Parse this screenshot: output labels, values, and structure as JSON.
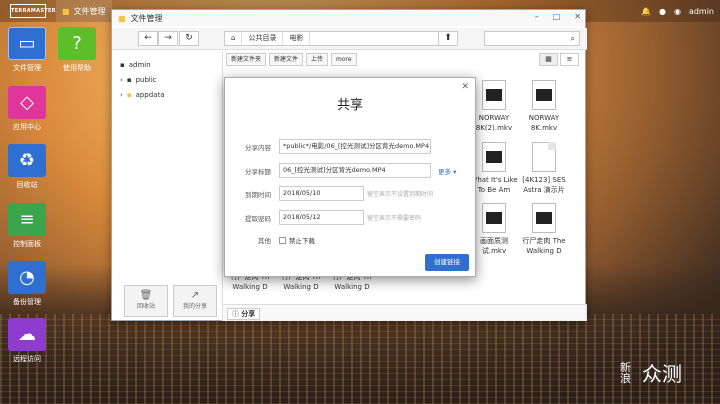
{
  "topbar": {
    "logo": "TERRAMASTER",
    "app_tab": "文件管理",
    "user": "admin"
  },
  "desktop": [
    {
      "label": "文件管理",
      "icon": "folder-icon",
      "color": "#2f6fd0"
    },
    {
      "label": "使用帮助",
      "icon": "help-icon",
      "color": "#5cbf2a"
    },
    {
      "label": "应用中心",
      "icon": "bag-icon",
      "color": "#e0359b"
    },
    {
      "label": "回收站",
      "icon": "recycle-icon",
      "color": "#2f6fd0"
    },
    {
      "label": "控制面板",
      "icon": "sliders-icon",
      "color": "#3aa54a"
    },
    {
      "label": "备份管理",
      "icon": "clock-icon",
      "color": "#2f6fd0"
    },
    {
      "label": "远程访问",
      "icon": "cloud-icon",
      "color": "#8e3bd0"
    }
  ],
  "window": {
    "title": "文件管理",
    "path": [
      "公共目录",
      "电影"
    ],
    "sidebar": [
      "admin",
      "public",
      "appdata"
    ],
    "toolbar": [
      "新建文件夹",
      "新建文件",
      "上传",
      "more"
    ],
    "files": [
      {
        "name": "NORWAY 8K(2).mkv",
        "type": "mv"
      },
      {
        "name": "NORWAY 8K.mkv",
        "type": "mv"
      },
      {
        "name": "What It's Like To Be Am",
        "type": "mv"
      },
      {
        "name": "[4K123] SES Astra 演示片",
        "type": "dc"
      },
      {
        "name": "画面质测试.mkv",
        "type": "mv"
      },
      {
        "name": "行尸走肉 The Walking D",
        "type": "mv"
      }
    ],
    "bottom_files": [
      "行尸走肉 Th Walking D",
      "行尸走肉 Th Walking D",
      "行尸走肉 Th Walking D"
    ],
    "side_buttons": [
      "回收站",
      "我的分享"
    ],
    "status": "分享"
  },
  "modal": {
    "title": "共享",
    "fields": {
      "content_label": "分享内容",
      "content_value": "*public*/电影/06_[控光测试]分区背光demo.MP4",
      "title_label": "分享标题",
      "title_value": "06_[控光测试]分区背光demo.MP4",
      "more": "更多",
      "expire_label": "到期时间",
      "expire_value": "2018/05/10",
      "expire_hint": "留空表示不设置到期时间",
      "code_label": "提取密码",
      "code_value": "2018/05/12",
      "code_hint": "留空表示不需要密码",
      "other_label": "其他",
      "no_download": "禁止下载"
    },
    "create_btn": "创建链接"
  },
  "watermark": {
    "text": "新浪",
    "brand": "众测"
  }
}
